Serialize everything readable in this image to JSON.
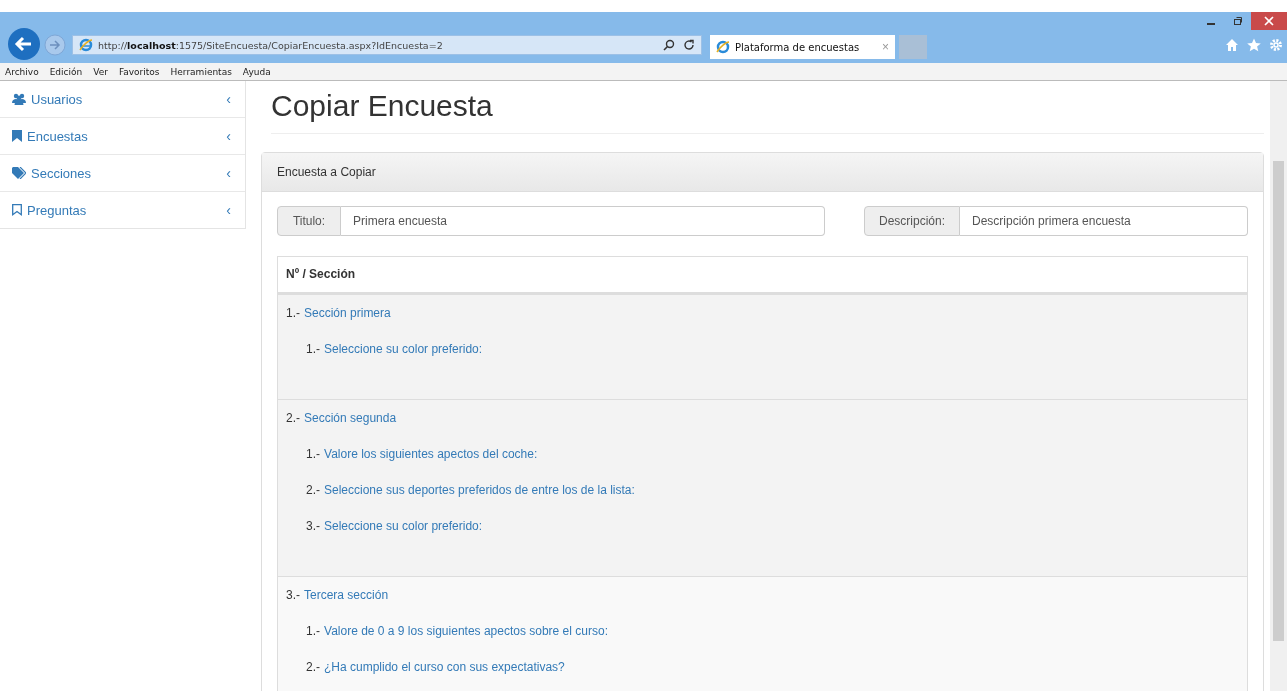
{
  "browser": {
    "address": {
      "prefix": "http://",
      "host": "localhost",
      "rest": ":1575/SiteEncuesta/CopiarEncuesta.aspx?IdEncuesta=2"
    },
    "tab": {
      "title": "Plataforma de encuestas",
      "close": "×"
    },
    "menu": [
      "Archivo",
      "Edición",
      "Ver",
      "Favoritos",
      "Herramientas",
      "Ayuda"
    ]
  },
  "sidebar": {
    "items": [
      {
        "label": "Usuarios",
        "kind": "users",
        "chevron": "‹"
      },
      {
        "label": "Encuestas",
        "kind": "bookmark",
        "chevron": "‹"
      },
      {
        "label": "Secciones",
        "kind": "tags",
        "chevron": "‹"
      },
      {
        "label": "Preguntas",
        "kind": "outline",
        "chevron": "‹"
      }
    ]
  },
  "page": {
    "title": "Copiar Encuesta",
    "panel": {
      "heading": "Encuesta a Copiar",
      "fields": [
        {
          "label": "Titulo:",
          "value": "Primera encuesta"
        },
        {
          "label": "Descripción:",
          "value": "Descripción primera encuesta"
        }
      ],
      "table": {
        "column": "Nº / Sección",
        "rows": [
          {
            "number": "1.-",
            "section": "Sección primera",
            "questions": [
              {
                "number": "1.-",
                "text": "Seleccione su color preferido:"
              }
            ]
          },
          {
            "number": "2.-",
            "section": "Sección segunda",
            "questions": [
              {
                "number": "1.-",
                "text": "Valore los siguientes apectos del coche:"
              },
              {
                "number": "2.-",
                "text": "Seleccione sus deportes preferidos de entre los de la lista:"
              },
              {
                "number": "3.-",
                "text": "Seleccione su color preferido:"
              }
            ]
          },
          {
            "number": "3.-",
            "section": "Tercera sección",
            "questions": [
              {
                "number": "1.-",
                "text": "Valore de 0 a 9 los siguientes apectos sobre el curso:"
              },
              {
                "number": "2.-",
                "text": "¿Ha cumplido el curso con sus expectativas?"
              }
            ]
          }
        ]
      }
    }
  }
}
